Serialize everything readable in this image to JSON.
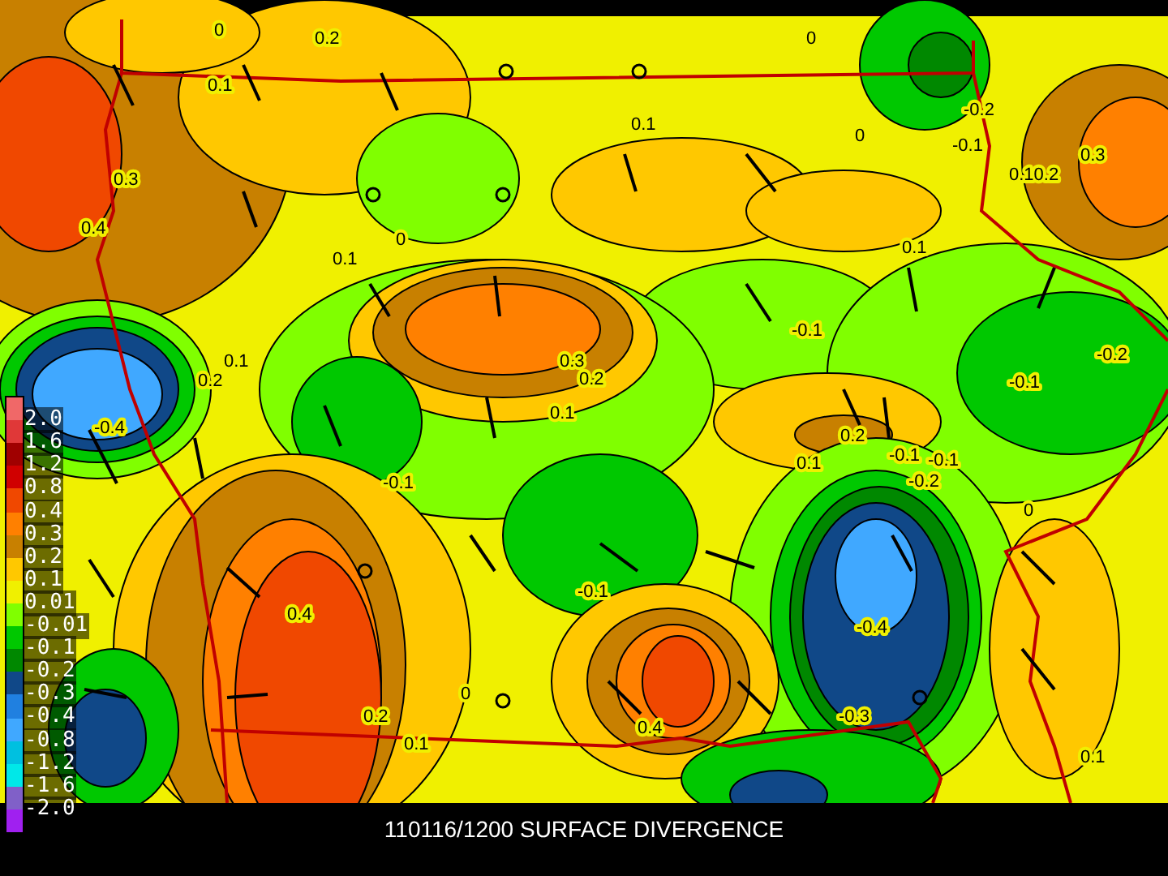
{
  "map": {
    "contour_labels": [
      "0",
      "0.2",
      "0.1",
      "0",
      "0.1",
      "-0.2",
      "0",
      "-0.1",
      "0.3",
      "0.4",
      "0.10.2",
      "0.3",
      "0",
      "0.1",
      "0.1",
      "0.1",
      "0.2",
      "-0.1",
      "-0.2",
      "-0.4",
      "0.3",
      "0.2",
      "0.1",
      "0.2",
      "-0.1",
      "0.1",
      "-0.1",
      "-0.1",
      "-0.2",
      "-0.1",
      "0",
      "-0.1",
      "0.4",
      "-0.4",
      "0.2",
      "0",
      "0.4",
      "-0.3",
      "0.1",
      "0.1"
    ]
  },
  "legend": {
    "swatches": [
      {
        "color": "#f06868"
      },
      {
        "color": "#e03838"
      },
      {
        "color": "#a00000"
      },
      {
        "color": "#d00000"
      },
      {
        "color": "#f04800"
      },
      {
        "color": "#ff8000"
      },
      {
        "color": "#c88000"
      },
      {
        "color": "#ffc800"
      },
      {
        "color": "#f0f000"
      },
      {
        "color": "#80ff00"
      },
      {
        "color": "#00c800"
      },
      {
        "color": "#008800"
      },
      {
        "color": "#104888"
      },
      {
        "color": "#2080e0"
      },
      {
        "color": "#40a8ff"
      },
      {
        "color": "#00c0e0"
      },
      {
        "color": "#00e8e8"
      },
      {
        "color": "#8060c8"
      },
      {
        "color": "#a020f0"
      }
    ],
    "labels": [
      "2.0",
      "1.6",
      "1.2",
      "0.8",
      "0.4",
      "0.3",
      "0.2",
      "0.1",
      "0.01",
      "-0.01",
      "-0.1",
      "-0.2",
      "-0.3",
      "-0.4",
      "-0.8",
      "-1.2",
      "-1.6",
      "-2.0"
    ]
  },
  "title": "110116/1200 SURFACE DIVERGENCE"
}
